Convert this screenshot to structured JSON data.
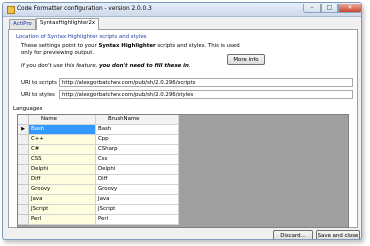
{
  "window": {
    "title": "Code Formatter configuration - version 2.0.0.3"
  },
  "tabs": [
    {
      "label": "ActiPro"
    },
    {
      "label": "SyntaxHighlighter2x"
    }
  ],
  "panel": {
    "section_title": "Location of Syntax Highlighter scripts and styles",
    "desc_line1": "These settings point to your Syntax Highlighter scripts and styles.  This is used",
    "desc_line2": "only for previewing output.",
    "note": "If you don't use this feature, you don't need to fill these in.",
    "more_info_label": "More info",
    "scripts_label": "URI to scripts",
    "scripts_value": "http://alexgorbatchev.com/pub/sh/2.0.296/scripts",
    "styles_label": "URI to styles",
    "styles_value": "http://alexgorbatchev.com/pub/sh/2.0.296/styles",
    "languages_label": "Languages"
  },
  "grid": {
    "columns": [
      "Name",
      "BrushName"
    ],
    "rows": [
      {
        "name": "Bash",
        "brush": "Bash",
        "indicator": "▶"
      },
      {
        "name": "C++",
        "brush": "Cpp",
        "indicator": ""
      },
      {
        "name": "C#",
        "brush": "CSharp",
        "indicator": ""
      },
      {
        "name": "CSS",
        "brush": "Css",
        "indicator": ""
      },
      {
        "name": "Delphi",
        "brush": "Delphi",
        "indicator": ""
      },
      {
        "name": "Diff",
        "brush": "Diff",
        "indicator": ""
      },
      {
        "name": "Groovy",
        "brush": "Groovy",
        "indicator": ""
      },
      {
        "name": "Java",
        "brush": "Java",
        "indicator": ""
      },
      {
        "name": "JScript",
        "brush": "JScript",
        "indicator": ""
      },
      {
        "name": "Perl",
        "brush": "Perl",
        "indicator": ""
      }
    ]
  },
  "buttons": {
    "discard": "Discard...",
    "save": "Save and close"
  },
  "window_buttons": {
    "minimize": "–",
    "maximize": "□",
    "close": "✕"
  }
}
